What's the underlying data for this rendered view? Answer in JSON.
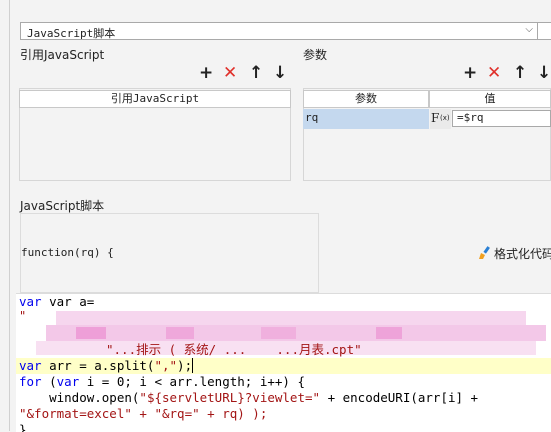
{
  "js_select": {
    "label": "JavaScript脚本"
  },
  "ref_panel": {
    "title": "引用JavaScript",
    "column": "引用JavaScript"
  },
  "params_panel": {
    "title": "参数",
    "columns": [
      "参数",
      "值"
    ],
    "rows": [
      {
        "name": "rq",
        "formula_icon": "F(x)",
        "value": "=$rq"
      }
    ]
  },
  "toolbar_icons": [
    "add-icon",
    "delete-icon",
    "move-up-icon",
    "move-down-icon"
  ],
  "script_section": {
    "title": "JavaScript脚本",
    "signature": "function(rq) {",
    "format_button": "格式化代码"
  },
  "code_lines": {
    "l1": "var a=",
    "l4": "\"...排示 ( 系统/ ...    ...月表.cpt\"",
    "l5": "var arr = a.split(\",\");",
    "l6": "for (var i = 0; i < arr.length; i++) {",
    "l7": "    window.open(\"${servletURL}?viewlet=\" + encodeURI(arr[i] +",
    "l8": "\"&format=excel\" + \"&rq=\" + rq) );",
    "l9": "}"
  },
  "colors": {
    "selected_cell": "#c4d8ee",
    "highlight_line": "#ffffc8",
    "delete": "#e0302a",
    "keyword": "#0000ee"
  }
}
